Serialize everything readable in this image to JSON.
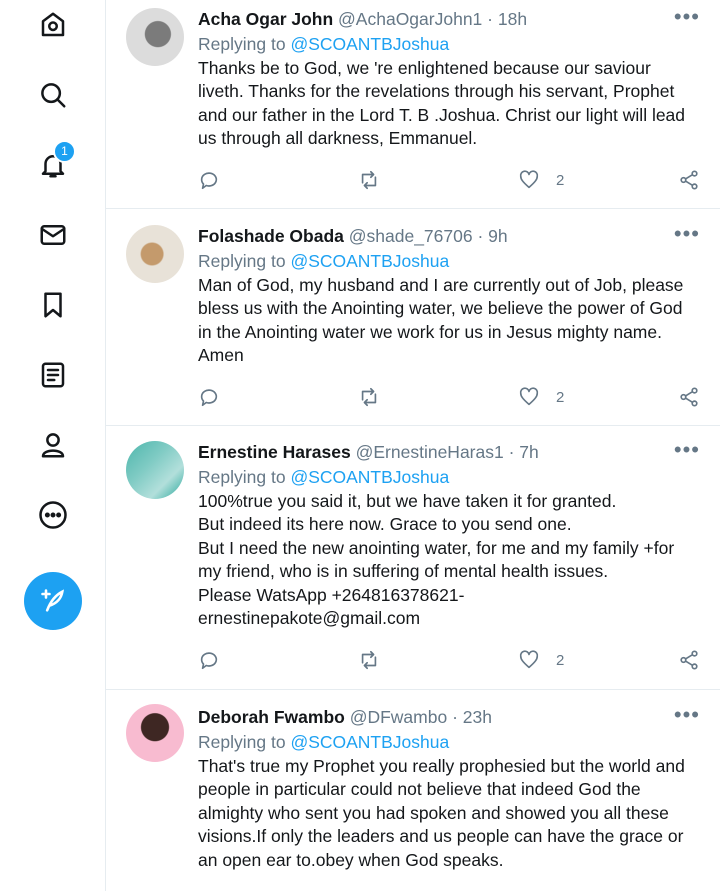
{
  "nav": {
    "notification_count": "1"
  },
  "tweets": [
    {
      "name": "Acha Ogar John",
      "handle": "@AchaOgarJohn1",
      "time": "18h",
      "replying_label": "Replying to",
      "replying_to": "@SCOANTBJoshua",
      "text": [
        "Thanks be to God, we 're enlightened because our saviour liveth. Thanks for the revelations through his servant, Prophet and our father in the Lord T. B .Joshua. Christ our light will lead us through all darkness, Emmanuel."
      ],
      "likes": "2"
    },
    {
      "name": "Folashade Obada",
      "handle": "@shade_76706",
      "time": "9h",
      "replying_label": "Replying to",
      "replying_to": "@SCOANTBJoshua",
      "text": [
        "Man of God, my husband and I are currently out of Job, please bless us with the Anointing water, we believe the power of God in the Anointing water we work for us in Jesus mighty name. Amen"
      ],
      "likes": "2"
    },
    {
      "name": "Ernestine Harases",
      "handle": "@ErnestineHaras1",
      "time": "7h",
      "replying_label": "Replying to",
      "replying_to": "@SCOANTBJoshua",
      "text": [
        "100%true you said it, but we have taken it for granted.",
        "But indeed its here now. Grace to you send one.",
        "But I need the new anointing water, for me and my family +for my friend, who is in suffering of mental health issues.",
        "Please WatsApp +264816378621-",
        "ernestinepakote@gmail.com"
      ],
      "likes": "2"
    },
    {
      "name": "Deborah Fwambo",
      "handle": "@DFwambo",
      "time": "23h",
      "replying_label": "Replying to",
      "replying_to": "@SCOANTBJoshua",
      "text": [
        "That's true my Prophet you really prophesied but the world and people in particular could not believe that indeed God the almighty who sent you had spoken and showed you all these visions.If only the leaders and us people can have the grace or an open ear to.obey when God speaks."
      ],
      "likes": ""
    }
  ]
}
